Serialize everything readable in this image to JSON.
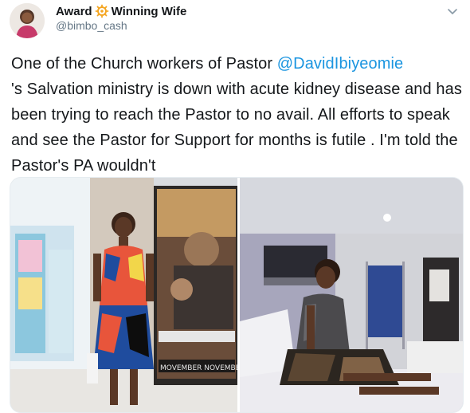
{
  "author": {
    "display_name_prefix": "Award",
    "display_name_suffix": "Winning Wife",
    "emoji_icon": "ship-wheel-emoji-icon",
    "handle": "@bimbo_cash"
  },
  "tweet": {
    "mention": "@DavidIbiyeomie",
    "text_before_mention": "One of the Church workers of Pastor ",
    "text_after_mention": "'s Salvation ministry is down with acute kidney disease and has been trying to reach the Pastor to no avail.  All efforts to speak and see the Pastor for Support for months is futile . I'm told the Pastor's PA wouldn't"
  },
  "media": {
    "left_image": {
      "description_icon": "woman-standing-photo",
      "poster_text_bottom": "MOVEMBER NOVEMBER"
    },
    "right_image": {
      "description_icon": "woman-hospital-bed-photo"
    }
  },
  "colors": {
    "mention": "#1b95e0",
    "text": "#14171a",
    "secondary": "#657786"
  }
}
